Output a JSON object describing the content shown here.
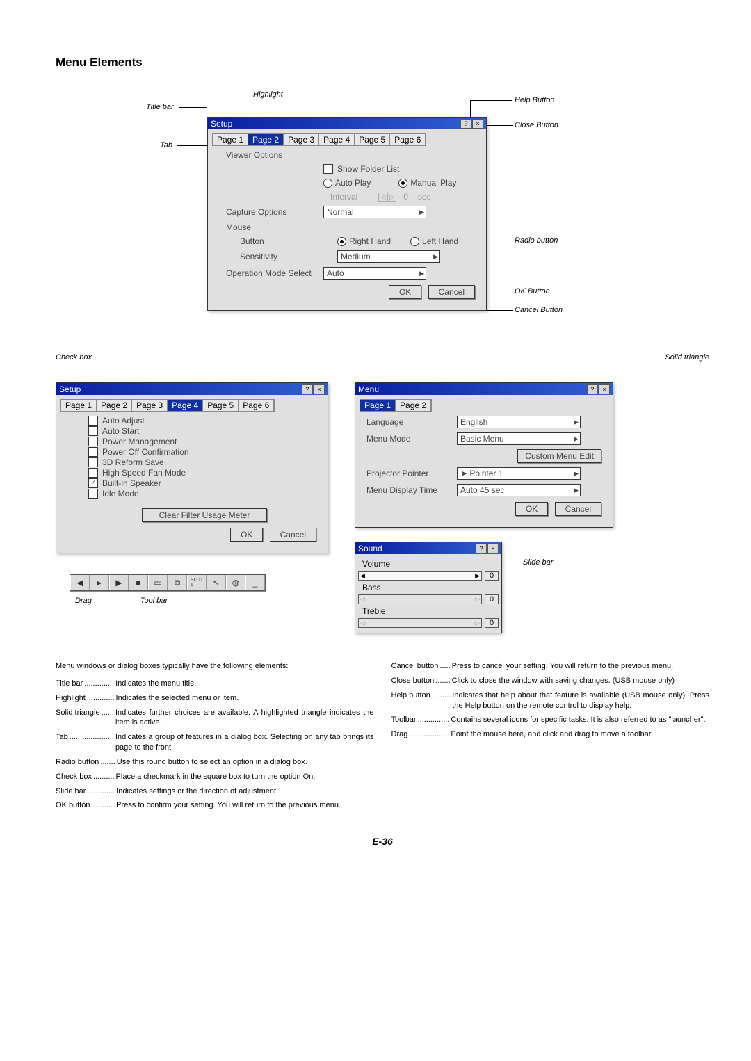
{
  "heading": "Menu Elements",
  "callouts": {
    "titlebar": "Title bar",
    "highlight": "Highlight",
    "help": "Help Button",
    "close": "Close Button",
    "tab": "Tab",
    "radio": "Radio button",
    "ok": "OK Button",
    "cancel": "Cancel Button",
    "solid_tri": "Solid triangle",
    "checkbox": "Check box",
    "drag": "Drag",
    "toolbar": "Tool bar",
    "slidebar": "Slide bar"
  },
  "dlg_main": {
    "title": "Setup",
    "tabs": [
      "Page 1",
      "Page 2",
      "Page 3",
      "Page 4",
      "Page 5",
      "Page 6"
    ],
    "active_tab": 1,
    "viewer_label": "Viewer Options",
    "show_folder": "Show Folder List",
    "auto_play": "Auto Play",
    "manual_play": "Manual Play",
    "interval": "Interval",
    "interval_val": "0",
    "interval_unit": "sec",
    "capture_label": "Capture Options",
    "capture_val": "Normal",
    "mouse": "Mouse",
    "button": "Button",
    "right_hand": "Right Hand",
    "left_hand": "Left Hand",
    "sensitivity": "Sensitivity",
    "sens_val": "Medium",
    "opmode": "Operation Mode Select",
    "opmode_val": "Auto",
    "ok": "OK",
    "cancel": "Cancel"
  },
  "dlg_setup4": {
    "title": "Setup",
    "tabs": [
      "Page 1",
      "Page 2",
      "Page 3",
      "Page 4",
      "Page 5",
      "Page 6"
    ],
    "active_tab": 3,
    "items": [
      {
        "label": "Auto Adjust",
        "checked": false
      },
      {
        "label": "Auto Start",
        "checked": false
      },
      {
        "label": "Power Management",
        "checked": false
      },
      {
        "label": "Power Off Confirmation",
        "checked": false
      },
      {
        "label": "3D Reform Save",
        "checked": false
      },
      {
        "label": "High Speed Fan Mode",
        "checked": false
      },
      {
        "label": "Built-in Speaker",
        "checked": true
      },
      {
        "label": "Idle Mode",
        "checked": false
      }
    ],
    "clear_btn": "Clear Filter Usage Meter",
    "ok": "OK",
    "cancel": "Cancel"
  },
  "dlg_menu": {
    "title": "Menu",
    "tabs": [
      "Page 1",
      "Page 2"
    ],
    "active_tab": 0,
    "lang_lbl": "Language",
    "lang_val": "English",
    "mode_lbl": "Menu Mode",
    "mode_val": "Basic Menu",
    "cme": "Custom Menu Edit",
    "pp_lbl": "Projector Pointer",
    "pp_val": "Pointer 1",
    "mdt_lbl": "Menu Display Time",
    "mdt_val": "Auto 45 sec",
    "ok": "OK",
    "cancel": "Cancel"
  },
  "dlg_sound": {
    "title": "Sound",
    "volume": "Volume",
    "vol_val": "0",
    "bass": "Bass",
    "bass_val": "0",
    "treble": "Treble",
    "treble_val": "0"
  },
  "intro": "Menu windows or dialog boxes typically have the following elements:",
  "defs_left": [
    {
      "t": "Title bar",
      "dots": "..............",
      "d": "Indicates the menu title."
    },
    {
      "t": "Highlight",
      "dots": ".............",
      "d": "Indicates the selected menu or item."
    },
    {
      "t": "Solid triangle",
      "dots": "......",
      "d": "Indicates further choices are available. A highlighted triangle indicates the item is active."
    },
    {
      "t": "Tab",
      "dots": ".....................",
      "d": "Indicates a group of features in a dialog box. Selecting on any tab brings its page to the front."
    },
    {
      "t": "Radio button",
      "dots": ".......",
      "d": "Use this round button to select an option in a dialog box."
    },
    {
      "t": "Check box",
      "dots": "..........",
      "d": "Place a checkmark in the square box to turn the option On."
    },
    {
      "t": "Slide bar",
      "dots": ".............",
      "d": "Indicates settings or the direction of adjustment."
    },
    {
      "t": "OK button",
      "dots": "...........",
      "d": "Press to confirm your setting. You will return to the previous menu."
    }
  ],
  "defs_right": [
    {
      "t": "Cancel button",
      "dots": ".....",
      "d": "Press to cancel your setting. You will return to the previous menu."
    },
    {
      "t": "Close button",
      "dots": ".......",
      "d": "Click to close the window with saving changes. (USB mouse only)"
    },
    {
      "t": "Help button",
      "dots": ".........",
      "d": "Indicates that help about that feature is available (USB mouse only). Press the Help button on the remote control to display help."
    },
    {
      "t": "Toolbar",
      "dots": "...............",
      "d": "Contains several icons for specific tasks. It is also referred to as \"launcher\"."
    },
    {
      "t": "Drag",
      "dots": "...................",
      "d": "Point the mouse here, and click and drag to move a toolbar."
    }
  ],
  "page_num": "E-36"
}
